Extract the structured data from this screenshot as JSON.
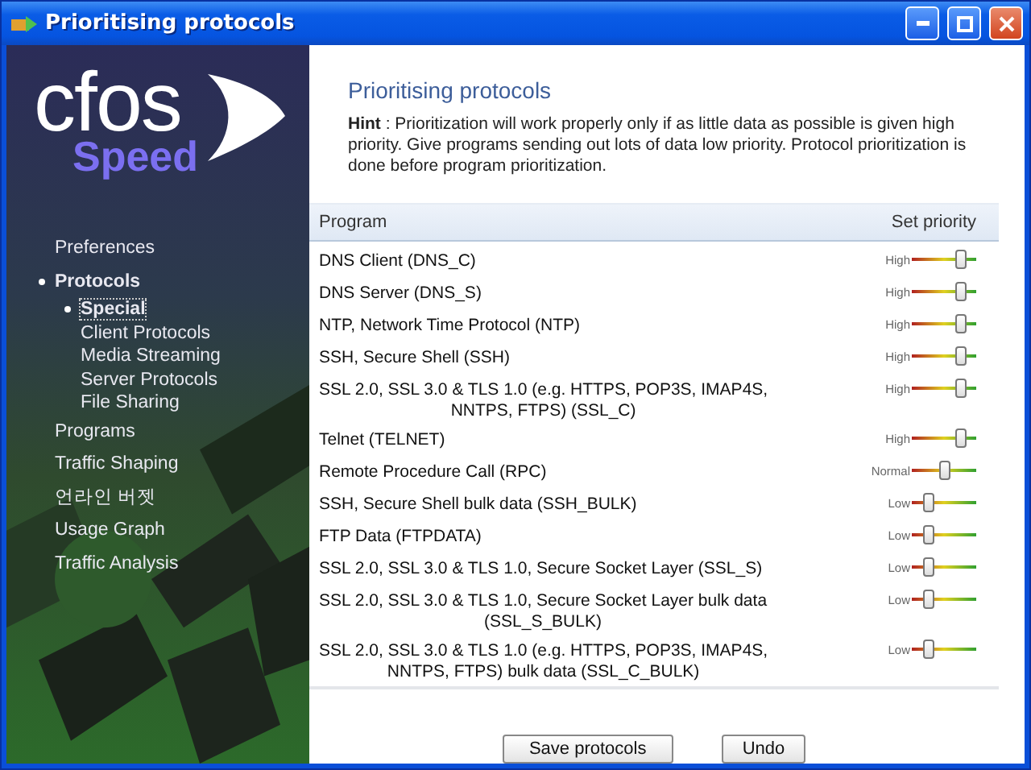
{
  "window": {
    "title": "Prioritising protocols"
  },
  "logo": {
    "name": "cfos",
    "tagline": "Speed"
  },
  "sidebar": {
    "items": [
      {
        "label": "Preferences",
        "selected": false
      },
      {
        "label": "Protocols",
        "selected": true,
        "children": [
          {
            "label": "Special",
            "selected": true
          },
          {
            "label": "Client Protocols",
            "selected": false
          },
          {
            "label": "Media Streaming",
            "selected": false
          },
          {
            "label": "Server Protocols",
            "selected": false
          },
          {
            "label": "File Sharing",
            "selected": false
          }
        ]
      },
      {
        "label": "Programs",
        "selected": false
      },
      {
        "label": "Traffic Shaping",
        "selected": false
      },
      {
        "label": "언라인 버젯",
        "selected": false
      },
      {
        "label": "Usage Graph",
        "selected": false
      },
      {
        "label": "Traffic Analysis",
        "selected": false
      }
    ]
  },
  "page": {
    "heading": "Prioritising protocols",
    "hint": "**Hint** : Prioritization will work properly only if as little data as possible is given high priority. Give programs sending out lots of data low priority. Protocol prioritization is done before program prioritization."
  },
  "table": {
    "columns": [
      "Program",
      "Set priority"
    ],
    "rows": [
      {
        "program": "DNS Client (DNS_C)",
        "priority": "High",
        "level": 0.75
      },
      {
        "program": "DNS Server (DNS_S)",
        "priority": "High",
        "level": 0.75
      },
      {
        "program": "NTP, Network Time Protocol (NTP)",
        "priority": "High",
        "level": 0.75
      },
      {
        "program": "SSH, Secure Shell (SSH)",
        "priority": "High",
        "level": 0.75
      },
      {
        "program": "SSL 2.0, SSL 3.0 & TLS 1.0 (e.g. HTTPS, POP3S, IMAP4S,\nNNTPS, FTPS) (SSL_C)",
        "priority": "High",
        "level": 0.75
      },
      {
        "program": "Telnet (TELNET)",
        "priority": "High",
        "level": 0.75
      },
      {
        "program": "Remote Procedure Call (RPC)",
        "priority": "Normal",
        "level": 0.5
      },
      {
        "program": "SSH, Secure Shell bulk data (SSH_BULK)",
        "priority": "Low",
        "level": 0.25
      },
      {
        "program": "FTP Data (FTPDATA)",
        "priority": "Low",
        "level": 0.25
      },
      {
        "program": "SSL 2.0, SSL 3.0 & TLS 1.0, Secure Socket Layer (SSL_S)",
        "priority": "Low",
        "level": 0.25
      },
      {
        "program": "SSL 2.0, SSL 3.0 & TLS 1.0, Secure Socket Layer bulk data\n(SSL_S_BULK)",
        "priority": "Low",
        "level": 0.25
      },
      {
        "program": "SSL 2.0, SSL 3.0 & TLS 1.0 (e.g. HTTPS, POP3S, IMAP4S,\nNNTPS, FTPS) bulk data (SSL_C_BULK)",
        "priority": "Low",
        "level": 0.25
      }
    ]
  },
  "buttons": [
    "Save protocols",
    "Undo"
  ]
}
